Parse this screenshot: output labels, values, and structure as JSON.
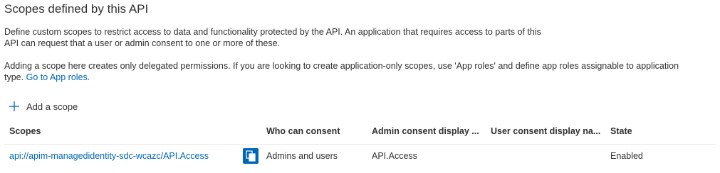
{
  "section": {
    "title": "Scopes defined by this API",
    "description_line1": "Define custom scopes to restrict access to data and functionality protected by the API. An application that requires access to parts of this",
    "description_line2": "API can request that a user or admin consent to one or more of these.",
    "note_line1": "Adding a scope here creates only delegated permissions. If you are looking to create application-only scopes, use 'App roles' and define app roles assignable to application",
    "note_line2_prefix": "type.",
    "note_link": "Go to App roles."
  },
  "toolbar": {
    "add_scope_label": "Add a scope",
    "add_icon": "plus-icon"
  },
  "table": {
    "headers": {
      "scopes": "Scopes",
      "who_can_consent": "Who can consent",
      "admin_display": "Admin consent display ...",
      "user_display": "User consent display na...",
      "state": "State"
    },
    "rows": [
      {
        "scope": "api://apim-managedidentity-sdc-wcazc/API.Access",
        "copy_icon": "copy-icon",
        "who_can_consent": "Admins and users",
        "admin_display": "API.Access",
        "user_display": "",
        "state": "Enabled"
      }
    ]
  },
  "colors": {
    "link": "#0067b8",
    "text": "#323130",
    "divider": "#edebe9"
  }
}
